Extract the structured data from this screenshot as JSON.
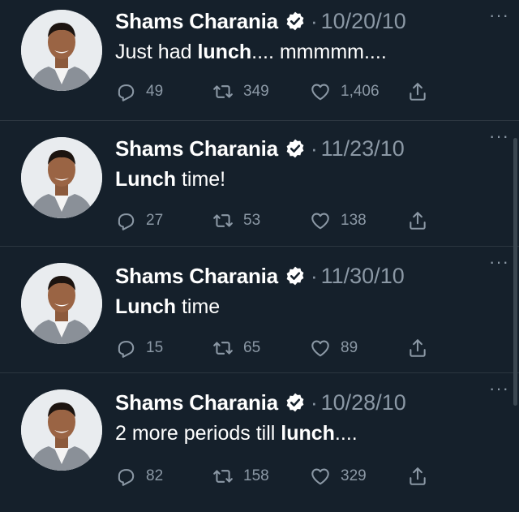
{
  "colors": {
    "background": "#15202b",
    "divider": "#2c3640",
    "secondary_text": "#8b98a5",
    "verified_badge": "#ffffff"
  },
  "icons": {
    "reply": "reply-icon",
    "retweet": "retweet-icon",
    "like": "like-icon",
    "share": "share-icon",
    "verified": "verified-badge-icon",
    "more": "more-options-icon"
  },
  "tweets": [
    {
      "name": "Shams Charania",
      "separator": "·",
      "date": "10/20/10",
      "more": "···",
      "text": {
        "before": "Just had ",
        "bold": "lunch",
        "after": ".... mmmmm...."
      },
      "replies": "49",
      "retweets": "349",
      "likes": "1,406"
    },
    {
      "name": "Shams Charania",
      "separator": "·",
      "date": "11/23/10",
      "more": "···",
      "text": {
        "before": "",
        "bold": "Lunch",
        "after": " time!"
      },
      "replies": "27",
      "retweets": "53",
      "likes": "138"
    },
    {
      "name": "Shams Charania",
      "separator": "·",
      "date": "11/30/10",
      "more": "···",
      "text": {
        "before": "",
        "bold": "Lunch",
        "after": " time"
      },
      "replies": "15",
      "retweets": "65",
      "likes": "89"
    },
    {
      "name": "Shams Charania",
      "separator": "·",
      "date": "10/28/10",
      "more": "···",
      "text": {
        "before": "2 more periods till ",
        "bold": "lunch",
        "after": "...."
      },
      "replies": "82",
      "retweets": "158",
      "likes": "329"
    }
  ]
}
